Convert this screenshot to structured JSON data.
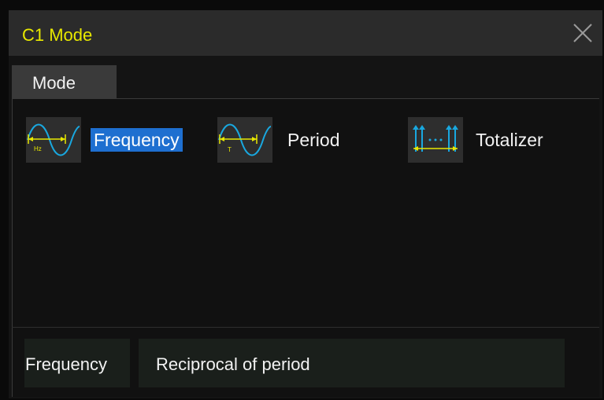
{
  "dialog": {
    "title": "C1 Mode",
    "close_icon": "close-icon"
  },
  "tabs": [
    {
      "label": "Mode",
      "active": true
    }
  ],
  "options": [
    {
      "label": "Frequency",
      "icon": "frequency-wave-icon",
      "selected": true
    },
    {
      "label": "Period",
      "icon": "period-wave-icon",
      "selected": false
    },
    {
      "label": "Totalizer",
      "icon": "totalizer-pulse-icon",
      "selected": false
    }
  ],
  "description": {
    "key": "Frequency",
    "value": "Reciprocal of period"
  },
  "colors": {
    "title": "#e8e800",
    "selection": "#1e6fd0",
    "wave": "#19a8e0",
    "marker": "#e8e800"
  }
}
